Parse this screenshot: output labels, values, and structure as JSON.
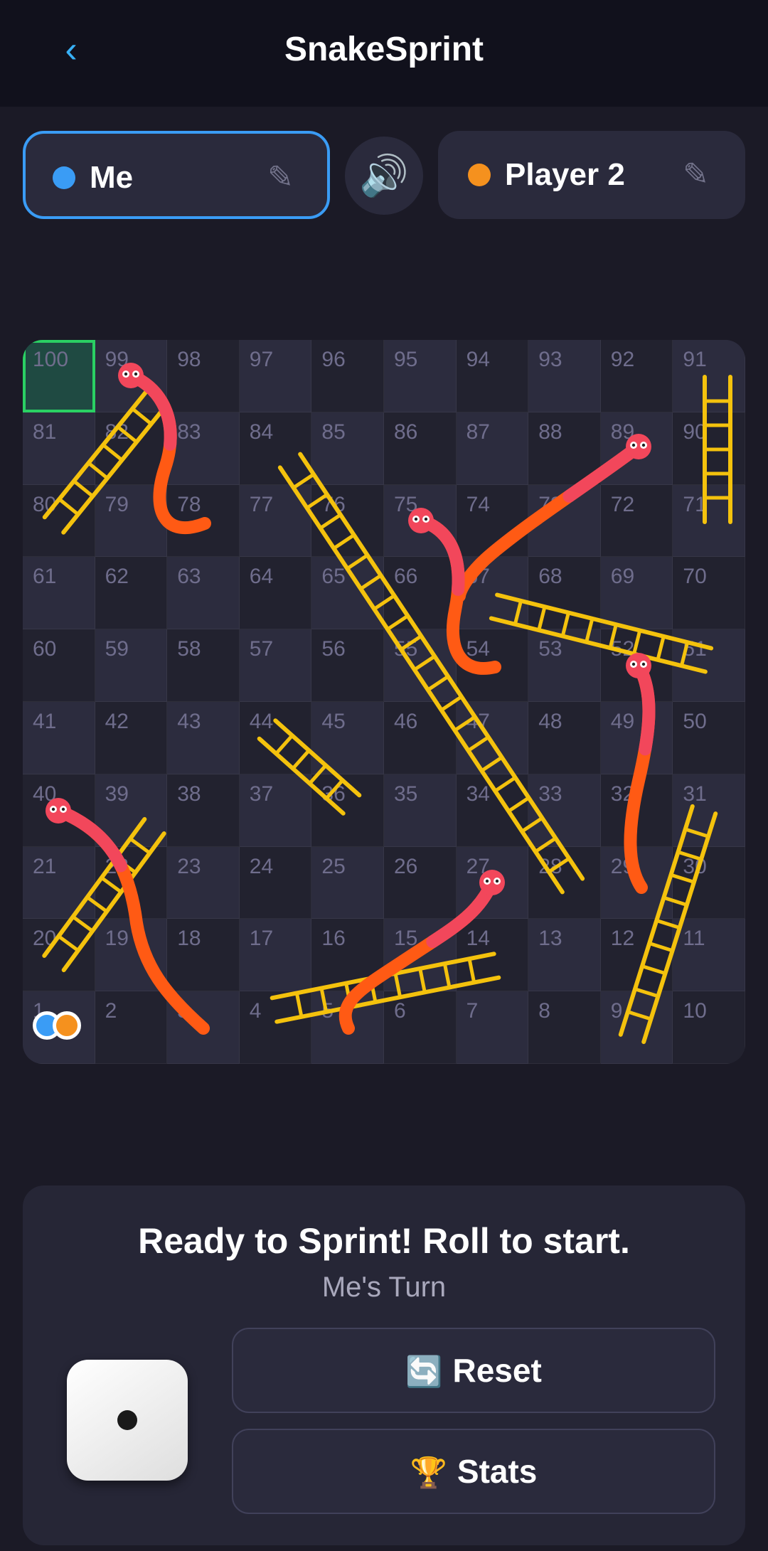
{
  "header": {
    "back_label": "‹",
    "title": "SnakeSprint"
  },
  "players": [
    {
      "name": "Me",
      "color": "#3a9cf5",
      "edit_icon": "✎",
      "active": true
    },
    {
      "name": "Player 2",
      "color": "#f5911e",
      "edit_icon": "✎",
      "active": false
    }
  ],
  "sound": {
    "icon": "🔊"
  },
  "board": {
    "cells": [
      100,
      99,
      98,
      97,
      96,
      95,
      94,
      93,
      92,
      91,
      81,
      82,
      83,
      84,
      85,
      86,
      87,
      88,
      89,
      90,
      80,
      79,
      78,
      77,
      76,
      75,
      74,
      73,
      72,
      71,
      61,
      62,
      63,
      64,
      65,
      66,
      67,
      68,
      69,
      70,
      60,
      59,
      58,
      57,
      56,
      55,
      54,
      53,
      52,
      51,
      41,
      42,
      43,
      44,
      45,
      46,
      47,
      48,
      49,
      50,
      40,
      39,
      38,
      37,
      36,
      35,
      34,
      33,
      32,
      31,
      21,
      22,
      23,
      24,
      25,
      26,
      27,
      28,
      29,
      30,
      20,
      19,
      18,
      17,
      16,
      15,
      14,
      13,
      12,
      11,
      1,
      2,
      3,
      4,
      5,
      6,
      7,
      8,
      9,
      10
    ],
    "goal_cell": 100,
    "ladder_color": "#f4c20d",
    "snake_head_color": "#f2475b",
    "snake_tail_color": "#ff5a14",
    "tokens_on_cell": 1
  },
  "panel": {
    "status": "Ready to Sprint! Roll to start.",
    "turn": "Me's Turn",
    "dice_value": 1,
    "reset_icon": "🔄",
    "reset_label": "Reset",
    "stats_icon": "🏆",
    "stats_label": "Stats"
  }
}
